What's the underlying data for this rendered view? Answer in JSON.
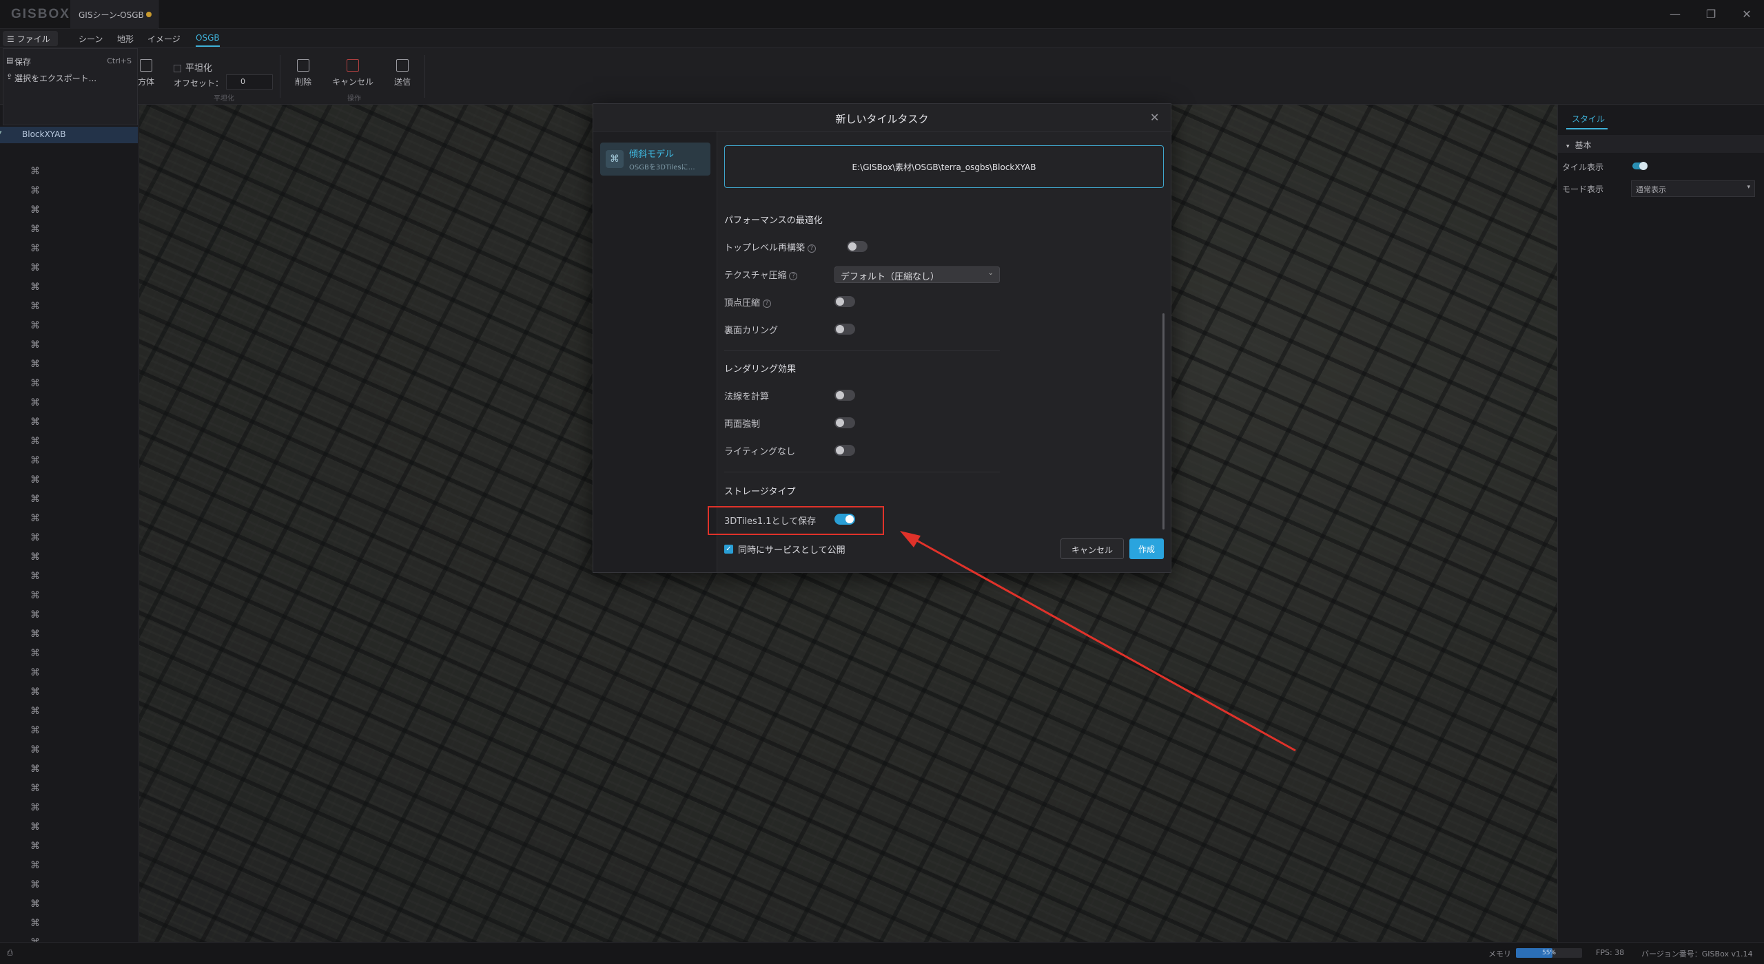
{
  "titlebar": {
    "logo": "GISBOX",
    "doc_tab": "GISシーン-OSGB",
    "min": "—",
    "max": "❐",
    "close": "✕"
  },
  "menubar": {
    "file": "☰ ファイル",
    "scene": "シーン",
    "terrain": "地形",
    "image": "イメージ",
    "osgb": "OSGB"
  },
  "file_menu": {
    "save": "保存",
    "save_kb": "Ctrl+S",
    "export": "選択をエクスポート..."
  },
  "toolbar": {
    "cube": "方体",
    "flatten_label": "平坦化",
    "offset_label": "オフセット：",
    "offset_value": "0",
    "group_flatten": "平坦化",
    "delete": "削除",
    "cancel": "キャンセル",
    "send": "送信",
    "group_ops": "操作"
  },
  "tree": {
    "root": "BlockXYAB"
  },
  "right_panel": {
    "tab": "スタイル",
    "section": "基本",
    "tile_display": "タイル表示",
    "mode_display": "モード表示",
    "mode_value": "通常表示"
  },
  "status": {
    "mem_label": "メモリ",
    "mem_value": "55%",
    "mem_fraction": 0.55,
    "fps": "FPS: 38",
    "version": "バージョン番号：GISBox v1.14"
  },
  "dialog": {
    "title": "新しいタイルタスク",
    "close": "✕",
    "model_title": "傾斜モデル",
    "model_sub": "OSGBを3DTilesに…",
    "path": "E:\\GISBox\\素材\\OSGB\\terra_osgbs\\BlockXYAB",
    "perf_title": "パフォーマンスの最適化",
    "opt_top_rebuild": "トップレベル再構築",
    "opt_tex_compress": "テクスチャ圧縮",
    "tex_value": "デフォルト（圧縮なし）",
    "opt_vertex": "頂点圧縮",
    "opt_backface": "裏面カリング",
    "render_title": "レンダリング効果",
    "opt_normals": "法線を計算",
    "opt_double": "両面強制",
    "opt_nolight": "ライティングなし",
    "storage_title": "ストレージタイプ",
    "opt_save3d": "3DTiles1.1として保存",
    "publish": "同時にサービスとして公開",
    "btn_cancel": "キャンセル",
    "btn_create": "作成"
  },
  "colors": {
    "accent": "#2aa4de",
    "highlight": "#e0322a"
  }
}
